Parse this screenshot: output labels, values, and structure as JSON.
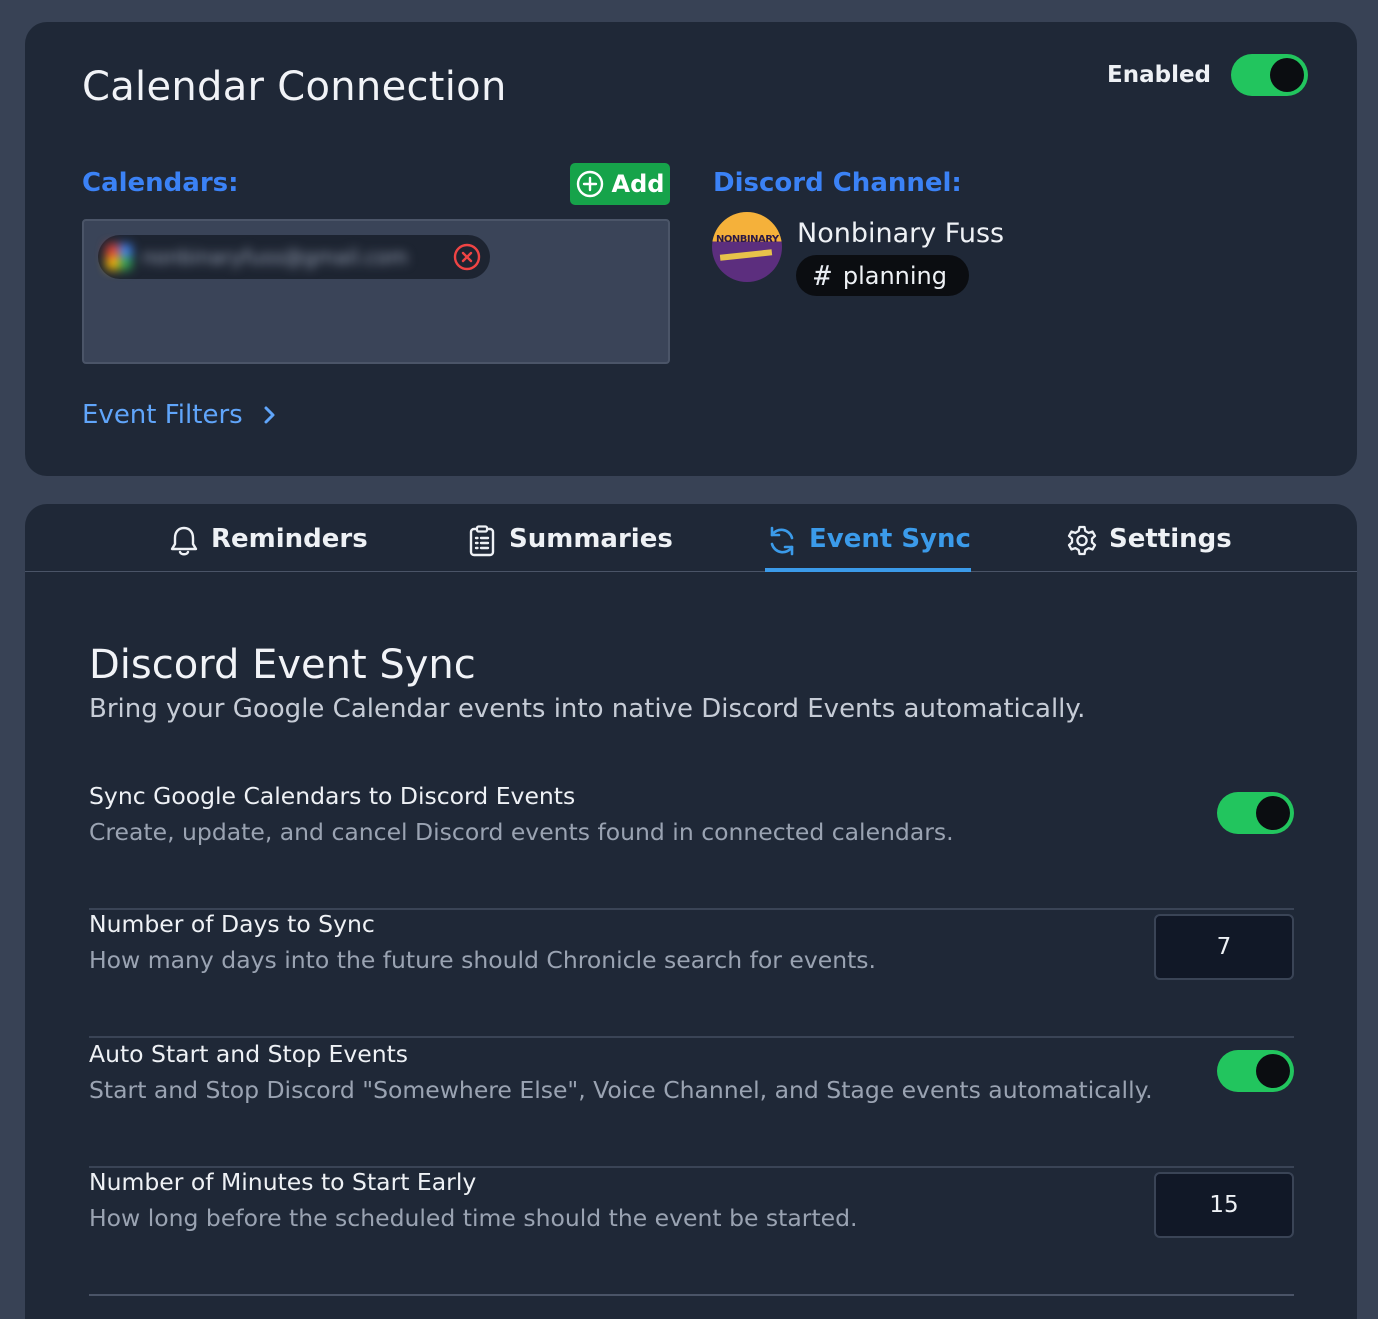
{
  "connection": {
    "title": "Calendar Connection",
    "enabled_label": "Enabled",
    "enabled": true,
    "calendars_label": "Calendars:",
    "add_label": "Add",
    "calendar_email": "nonbinaryfuss@gmail.com",
    "event_filters_label": "Event Filters",
    "discord_label": "Discord Channel:",
    "server_name": "Nonbinary Fuss",
    "avatar_text": "NONBINARY",
    "channel_name": "planning"
  },
  "tabs": [
    {
      "label": "Reminders",
      "icon": "bell-icon"
    },
    {
      "label": "Summaries",
      "icon": "clipboard-list-icon"
    },
    {
      "label": "Event Sync",
      "icon": "refresh-icon",
      "active": true
    },
    {
      "label": "Settings",
      "icon": "gear-icon"
    }
  ],
  "event_sync": {
    "title": "Discord Event Sync",
    "subtitle": "Bring your Google Calendar events into native Discord Events automatically.",
    "settings": [
      {
        "title": "Sync Google Calendars to Discord Events",
        "description": "Create, update, and cancel Discord events found in connected calendars.",
        "type": "toggle",
        "enabled": true
      },
      {
        "title": "Number of Days to Sync",
        "description": "How many days into the future should Chronicle search for events.",
        "type": "number",
        "value": "7"
      },
      {
        "title": "Auto Start and Stop Events",
        "description": "Start and Stop Discord \"Somewhere Else\", Voice Channel, and Stage events automatically.",
        "type": "toggle",
        "enabled": true
      },
      {
        "title": "Number of Minutes to Start Early",
        "description": "How long before the scheduled time should the event be started.",
        "type": "number",
        "value": "15"
      }
    ]
  },
  "colors": {
    "background": "#384255",
    "card": "#1f2837",
    "accent_blue": "#3b82f6",
    "active_tab": "#3b9bea",
    "toggle_on": "#22c55e",
    "add_button": "#16a34a"
  }
}
